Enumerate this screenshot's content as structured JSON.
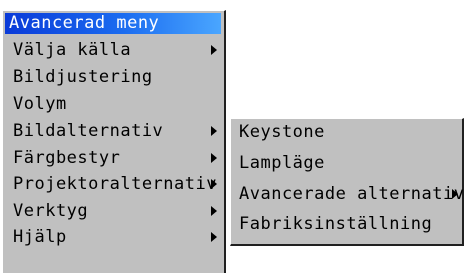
{
  "main_menu": {
    "title": "Avancerad meny",
    "items": [
      {
        "label": "Välja källa",
        "has_submenu": true
      },
      {
        "label": "Bildjustering",
        "has_submenu": false
      },
      {
        "label": "Volym",
        "has_submenu": false
      },
      {
        "label": "Bildalternativ",
        "has_submenu": true
      },
      {
        "label": "Färgbestyr",
        "has_submenu": true
      },
      {
        "label": "Projektoralternativ",
        "has_submenu": true
      },
      {
        "label": "Verktyg",
        "has_submenu": true
      },
      {
        "label": "Hjälp",
        "has_submenu": true
      }
    ]
  },
  "submenu": {
    "items": [
      {
        "label": "Keystone",
        "has_submenu": false
      },
      {
        "label": "Lampläge",
        "has_submenu": false
      },
      {
        "label": "Avancerade alternativ",
        "has_submenu": true
      },
      {
        "label": "Fabriksinställning",
        "has_submenu": false
      }
    ]
  },
  "colors": {
    "menu_background": "#c0c0c0",
    "title_bar_start": "#0a3ad8",
    "title_bar_end": "#4aa6ff",
    "title_text": "#ffffff"
  },
  "icons": {
    "submenu_indicator": "triangle-right-icon"
  }
}
